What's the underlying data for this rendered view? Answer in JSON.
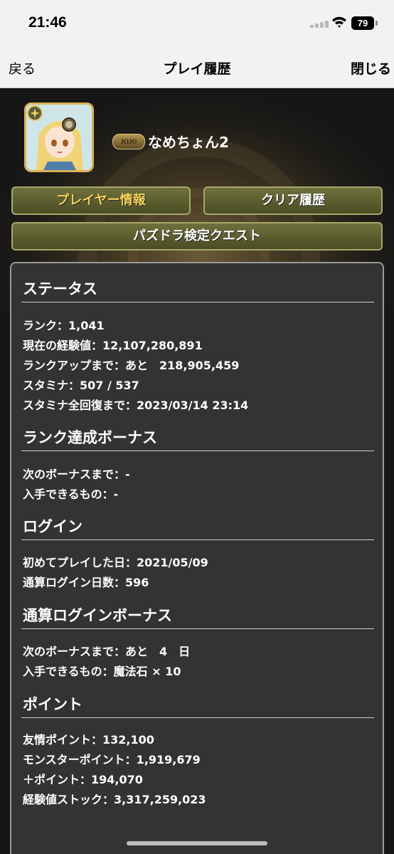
{
  "status_bar": {
    "time": "21:46",
    "battery": "79"
  },
  "nav": {
    "back": "戻る",
    "title": "プレイ履歴",
    "close": "閉じる"
  },
  "profile": {
    "badge": "JOJO",
    "name": "なめちょん2"
  },
  "buttons": {
    "player_info": "プレイヤー情報",
    "clear_history": "クリア履歴",
    "quest": "パズドラ検定クエスト"
  },
  "sections": {
    "status": {
      "title": "ステータス",
      "rank": "ランク：1,041",
      "exp": "現在の経験値：12,107,280,891",
      "rankup": "ランクアップまで：あと　218,905,459",
      "stamina": "スタミナ：507 / 537",
      "stamina_full": "スタミナ全回復まで：2023/03/14 23:14"
    },
    "rank_bonus": {
      "title": "ランク達成ボーナス",
      "next": "次のボーナスまで：-",
      "item": "入手できるもの：-"
    },
    "login": {
      "title": "ログイン",
      "first_play": "初めてプレイした日：2021/05/09",
      "days": "通算ログイン日数：596"
    },
    "login_bonus": {
      "title": "通算ログインボーナス",
      "next": "次のボーナスまで：あと　4　日",
      "item": "入手できるもの：魔法石 × 10"
    },
    "points": {
      "title": "ポイント",
      "friend": "友情ポイント：132,100",
      "monster": "モンスターポイント：1,919,679",
      "plus": "＋ポイント：194,070",
      "exp_stock": "経験値ストック：3,317,259,023"
    }
  }
}
